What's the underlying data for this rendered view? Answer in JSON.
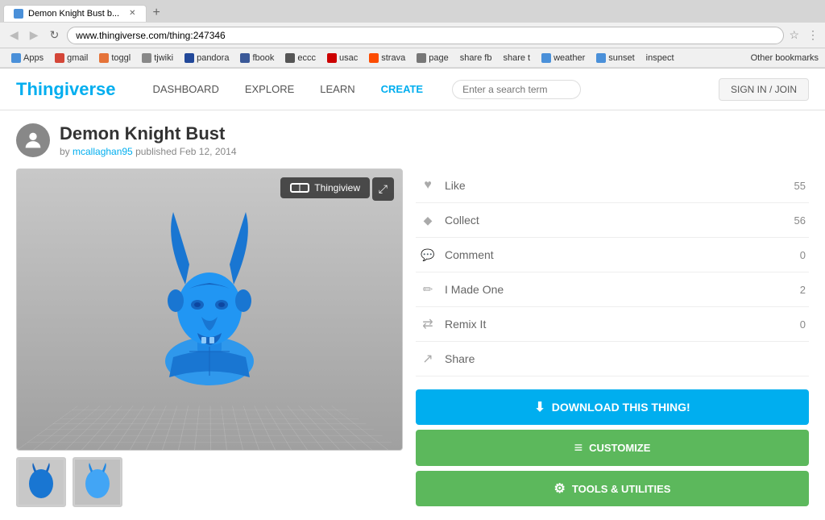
{
  "browser": {
    "tab_title": "Demon Knight Bust b...",
    "url": "www.thingiverse.com/thing:247346",
    "bookmarks": [
      "Apps",
      "gmail",
      "toggl",
      "tjwiki",
      "pandora",
      "fbook",
      "eccc",
      "usac",
      "strava",
      "page",
      "share fb",
      "share t",
      "weather",
      "sunset",
      "inspect"
    ],
    "other_bookmarks": "Other bookmarks"
  },
  "header": {
    "logo": "Thingiverse",
    "nav": [
      "DASHBOARD",
      "EXPLORE",
      "LEARN",
      "CREATE"
    ],
    "search_placeholder": "Enter a search term",
    "signin": "SIGN IN / JOIN"
  },
  "thing": {
    "title": "Demon Knight Bust",
    "author": "mcallaghan95",
    "published": "published Feb 12, 2014",
    "avatar_label": "user avatar"
  },
  "actions": [
    {
      "id": "like",
      "label": "Like",
      "count": "55",
      "icon": "heart"
    },
    {
      "id": "collect",
      "label": "Collect",
      "count": "56",
      "icon": "collect"
    },
    {
      "id": "comment",
      "label": "Comment",
      "count": "0",
      "icon": "comment"
    },
    {
      "id": "made",
      "label": "I Made One",
      "count": "2",
      "icon": "made"
    },
    {
      "id": "remix",
      "label": "Remix It",
      "count": "0",
      "icon": "remix"
    },
    {
      "id": "share",
      "label": "Share",
      "count": "",
      "icon": "share"
    }
  ],
  "buttons": {
    "download": "DOWNLOAD THIS THING!",
    "customize": "CUSTOMIZE",
    "tools": "TOOLS & UTILITIES"
  },
  "viewer": {
    "thingiview_btn": "Thingiview",
    "expand_btn": "⤢"
  }
}
